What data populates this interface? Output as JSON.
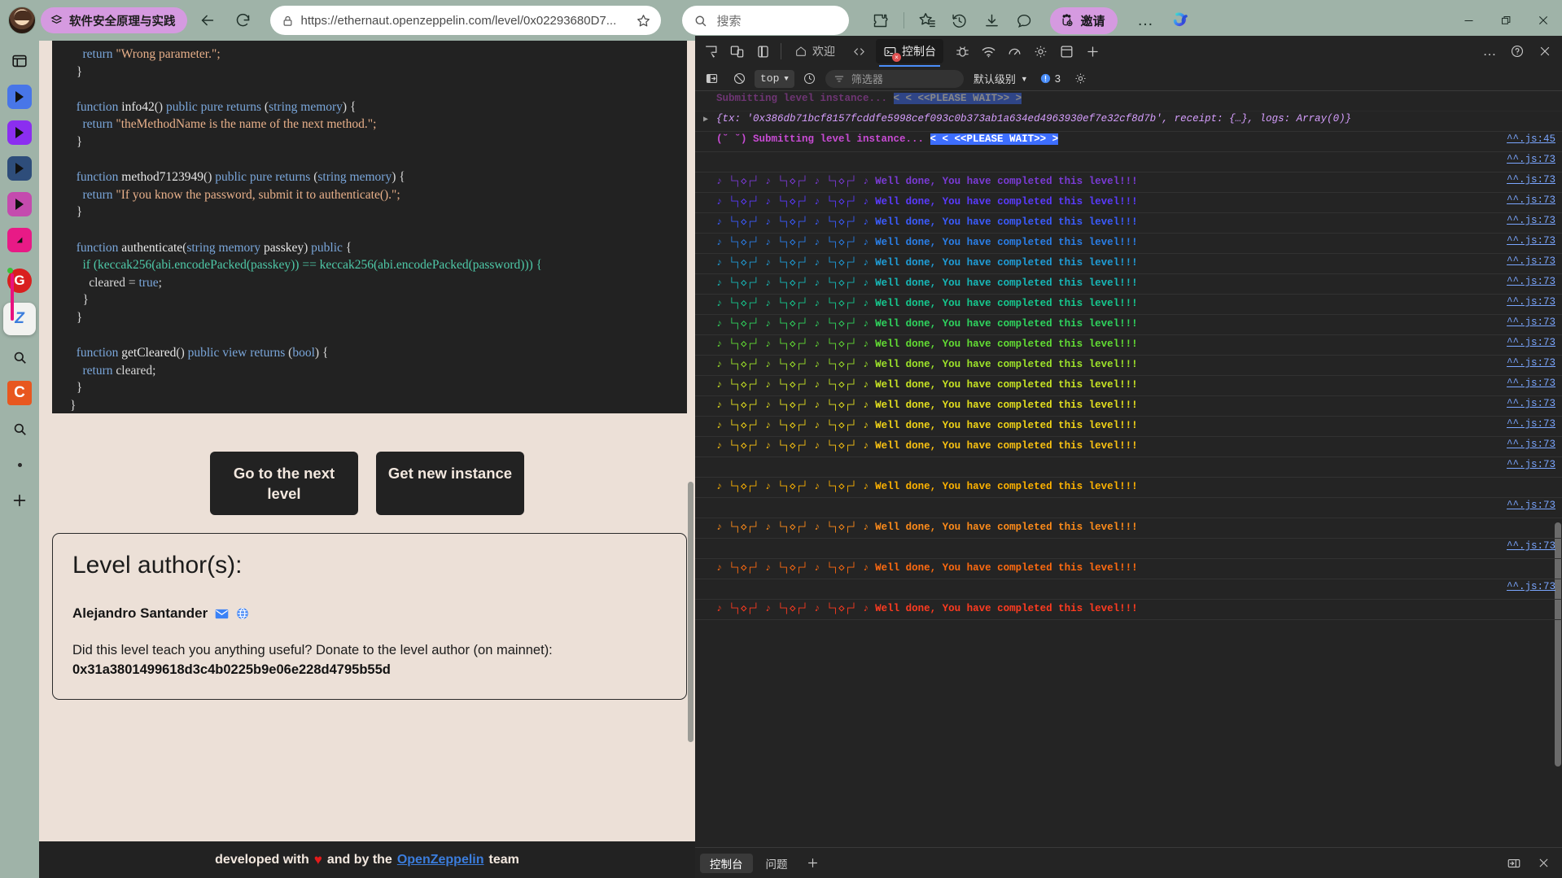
{
  "browser": {
    "profile_label": "软件安全原理与实践",
    "back_icon": "back-arrow-icon",
    "reload_icon": "reload-icon",
    "lock_icon": "lock-icon",
    "url": "https://ethernaut.openzeppelin.com/level/0x02293680D7...",
    "bookmark_icon": "star-icon",
    "search_placeholder": "搜索",
    "search_icon": "search-icon",
    "toolbar_icons": [
      "copilot-puzzle-icon",
      "favorites-icon",
      "history-icon",
      "downloads-icon",
      "chat-icon"
    ],
    "invite_label": "邀请",
    "more_label": "…",
    "window_buttons": [
      "minimize",
      "restore",
      "close"
    ]
  },
  "leftbar": {
    "items": [
      {
        "name": "split-screen-icon",
        "label": ""
      },
      {
        "name": "player-blue-icon",
        "label": ""
      },
      {
        "name": "player-purple-icon",
        "label": ""
      },
      {
        "name": "player-navy-icon",
        "label": ""
      },
      {
        "name": "player-magenta-icon",
        "label": ""
      },
      {
        "name": "player-pink-icon",
        "label": ""
      },
      {
        "name": "google-g-icon",
        "label": "G"
      },
      {
        "name": "zotero-icon",
        "label": "Z"
      },
      {
        "name": "search-icon",
        "label": ""
      },
      {
        "name": "c-app-icon",
        "label": "C"
      },
      {
        "name": "search-secondary-icon",
        "label": ""
      },
      {
        "name": "dot-icon",
        "label": ""
      },
      {
        "name": "add-icon",
        "label": "+"
      }
    ]
  },
  "page": {
    "code_lines": [
      [
        {
          "t": "    ",
          "c": "pl"
        },
        {
          "t": "return ",
          "c": "k"
        },
        {
          "t": "\"Wrong parameter.\";",
          "c": "str"
        }
      ],
      [
        {
          "t": "  }",
          "c": "pl"
        }
      ],
      [
        {
          "t": "",
          "c": "pl"
        }
      ],
      [
        {
          "t": "  ",
          "c": "pl"
        },
        {
          "t": "function ",
          "c": "k"
        },
        {
          "t": "info42",
          "c": "fn"
        },
        {
          "t": "() ",
          "c": "pl"
        },
        {
          "t": "public pure returns ",
          "c": "k"
        },
        {
          "t": "(",
          "c": "pl"
        },
        {
          "t": "string memory",
          "c": "ty"
        },
        {
          "t": ") {",
          "c": "pl"
        }
      ],
      [
        {
          "t": "    ",
          "c": "pl"
        },
        {
          "t": "return ",
          "c": "k"
        },
        {
          "t": "\"theMethodName is the name of the next method.\";",
          "c": "str"
        }
      ],
      [
        {
          "t": "  }",
          "c": "pl"
        }
      ],
      [
        {
          "t": "",
          "c": "pl"
        }
      ],
      [
        {
          "t": "  ",
          "c": "pl"
        },
        {
          "t": "function ",
          "c": "k"
        },
        {
          "t": "method7123949",
          "c": "fn"
        },
        {
          "t": "() ",
          "c": "pl"
        },
        {
          "t": "public pure returns ",
          "c": "k"
        },
        {
          "t": "(",
          "c": "pl"
        },
        {
          "t": "string memory",
          "c": "ty"
        },
        {
          "t": ") {",
          "c": "pl"
        }
      ],
      [
        {
          "t": "    ",
          "c": "pl"
        },
        {
          "t": "return ",
          "c": "k"
        },
        {
          "t": "\"If you know the password, submit it to authenticate().\";",
          "c": "str"
        }
      ],
      [
        {
          "t": "  }",
          "c": "pl"
        }
      ],
      [
        {
          "t": "",
          "c": "pl"
        }
      ],
      [
        {
          "t": "  ",
          "c": "pl"
        },
        {
          "t": "function ",
          "c": "k"
        },
        {
          "t": "authenticate",
          "c": "fn"
        },
        {
          "t": "(",
          "c": "pl"
        },
        {
          "t": "string memory ",
          "c": "ty"
        },
        {
          "t": "passkey",
          "c": "fn"
        },
        {
          "t": ") ",
          "c": "pl"
        },
        {
          "t": "public ",
          "c": "k"
        },
        {
          "t": "{",
          "c": "pl"
        }
      ],
      [
        {
          "t": "    ",
          "c": "pl"
        },
        {
          "t": "if ",
          "c": "grn"
        },
        {
          "t": "(keccak256(abi.encodePacked(passkey)) == keccak256(abi.encodePacked(password))) {",
          "c": "grn"
        }
      ],
      [
        {
          "t": "      cleared = ",
          "c": "pl"
        },
        {
          "t": "true",
          "c": "k"
        },
        {
          "t": ";",
          "c": "pl"
        }
      ],
      [
        {
          "t": "    }",
          "c": "pl"
        }
      ],
      [
        {
          "t": "  }",
          "c": "pl"
        }
      ],
      [
        {
          "t": "",
          "c": "pl"
        }
      ],
      [
        {
          "t": "  ",
          "c": "pl"
        },
        {
          "t": "function ",
          "c": "k"
        },
        {
          "t": "getCleared",
          "c": "fn"
        },
        {
          "t": "() ",
          "c": "pl"
        },
        {
          "t": "public view returns ",
          "c": "k"
        },
        {
          "t": "(",
          "c": "pl"
        },
        {
          "t": "bool",
          "c": "ty"
        },
        {
          "t": ") {",
          "c": "pl"
        }
      ],
      [
        {
          "t": "    ",
          "c": "pl"
        },
        {
          "t": "return ",
          "c": "k"
        },
        {
          "t": "cleared;",
          "c": "pl"
        }
      ],
      [
        {
          "t": "  }",
          "c": "pl"
        }
      ],
      [
        {
          "t": "}",
          "c": "pl"
        }
      ]
    ],
    "buttons": {
      "next_level": "Go to the next level",
      "new_instance": "Get new instance"
    },
    "author": {
      "title": "Level author(s):",
      "name": "Alejandro Santander",
      "mail_icon": "envelope-icon",
      "web_icon": "globe-icon",
      "donate_question": "Did this level teach you anything useful? Donate to the level author (on mainnet):",
      "donate_address": "0x31a3801499618d3c4b0225b9e06e228d4795b55d"
    },
    "footer": {
      "prefix": "developed with",
      "heart": "♥",
      "middle": "and  by the",
      "link": "OpenZeppelin",
      "suffix": "team"
    }
  },
  "devtools": {
    "tabs": [
      {
        "label": "欢迎",
        "icon": "home-icon",
        "active": false
      },
      {
        "label": "",
        "icon": "elements-icon",
        "active": false
      },
      {
        "label": "控制台",
        "icon": "console-icon",
        "active": true
      }
    ],
    "icon_tabs": [
      "inspect-icon",
      "device-toolbar-icon",
      "panel-layout-icon"
    ],
    "right_icons": [
      "debugger-icon",
      "network-icon",
      "performance-icon",
      "settings-gear-icon",
      "application-icon",
      "add-tab-icon"
    ],
    "more_label": "…",
    "help_icon": "help-icon",
    "close_icon": "close-icon",
    "toolbar": {
      "sidebar_icon": "console-sidebar-icon",
      "clear_icon": "clear-console-icon",
      "context": "top",
      "eye_icon": "live-expression-icon",
      "filter_placeholder": "筛选器",
      "filter_icon": "filter-icon",
      "level": "默认级别",
      "warn_icon": "warning-bubble-icon",
      "warn_count": "3",
      "settings_icon": "console-settings-icon"
    },
    "bottom_tabs": [
      {
        "label": "控制台",
        "active": true
      },
      {
        "label": "问题",
        "active": false
      }
    ],
    "bottom_add": "+",
    "bottom_right_icons": [
      "dock-icon",
      "close-drawer-icon"
    ],
    "console_rows": [
      {
        "kind": "partial",
        "text": "Submitting level instance...",
        "highlight": "< < <<PLEASE WAIT>> >",
        "src": ""
      },
      {
        "kind": "object",
        "text": "{tx: '0x386db71bcf8157fcddfe5998cef093c0b373ab1a634ed4963930ef7e32cf8d7b', receipt: {…}, logs: Array(0)}",
        "src": ""
      },
      {
        "kind": "submit",
        "text": "(˘ ˘) Submitting level instance...",
        "highlight": "< < <<PLEASE WAIT>> >",
        "src": "^^.js:45",
        "color": "#c84bd4"
      },
      {
        "kind": "blank",
        "text": "",
        "src": "^^.js:73"
      },
      {
        "kind": "done",
        "text": "♪ └┐◇┌┘ ♪ └┐◇┌┘ ♪ └┐◇┌┘ ♪ Well done, You have completed this level!!!",
        "src": "^^.js:73",
        "color": "#7a3bd6"
      },
      {
        "kind": "done",
        "text": "♪ └┐◇┌┘ ♪ └┐◇┌┘ ♪ └┐◇┌┘ ♪ Well done, You have completed this level!!!",
        "src": "^^.js:73",
        "color": "#5a3bff"
      },
      {
        "kind": "done",
        "text": "♪ └┐◇┌┘ ♪ └┐◇┌┘ ♪ └┐◇┌┘ ♪ Well done, You have completed this level!!!",
        "src": "^^.js:73",
        "color": "#3b5cff"
      },
      {
        "kind": "done",
        "text": "♪ └┐◇┌┘ ♪ └┐◇┌┘ ♪ └┐◇┌┘ ♪ Well done, You have completed this level!!!",
        "src": "^^.js:73",
        "color": "#2a7fe8"
      },
      {
        "kind": "done",
        "text": "♪ └┐◇┌┘ ♪ └┐◇┌┘ ♪ └┐◇┌┘ ♪ Well done, You have completed this level!!!",
        "src": "^^.js:73",
        "color": "#1f9ed8"
      },
      {
        "kind": "done",
        "text": "♪ └┐◇┌┘ ♪ └┐◇┌┘ ♪ └┐◇┌┘ ♪ Well done, You have completed this level!!!",
        "src": "^^.js:73",
        "color": "#17b8b8"
      },
      {
        "kind": "done",
        "text": "♪ └┐◇┌┘ ♪ └┐◇┌┘ ♪ └┐◇┌┘ ♪ Well done, You have completed this level!!!",
        "src": "^^.js:73",
        "color": "#16c98e"
      },
      {
        "kind": "done",
        "text": "♪ └┐◇┌┘ ♪ └┐◇┌┘ ♪ └┐◇┌┘ ♪ Well done, You have completed this level!!!",
        "src": "^^.js:73",
        "color": "#2fd45e"
      },
      {
        "kind": "done",
        "text": "♪ └┐◇┌┘ ♪ └┐◇┌┘ ♪ └┐◇┌┘ ♪ Well done, You have completed this level!!!",
        "src": "^^.js:73",
        "color": "#63dd33"
      },
      {
        "kind": "done",
        "text": "♪ └┐◇┌┘ ♪ └┐◇┌┘ ♪ └┐◇┌┘ ♪ Well done, You have completed this level!!!",
        "src": "^^.js:73",
        "color": "#9ee42a"
      },
      {
        "kind": "done",
        "text": "♪ └┐◇┌┘ ♪ └┐◇┌┘ ♪ └┐◇┌┘ ♪ Well done, You have completed this level!!!",
        "src": "^^.js:73",
        "color": "#c8e424"
      },
      {
        "kind": "done",
        "text": "♪ └┐◇┌┘ ♪ └┐◇┌┘ ♪ └┐◇┌┘ ♪ Well done, You have completed this level!!!",
        "src": "^^.js:73",
        "color": "#e4e01f"
      },
      {
        "kind": "done",
        "text": "♪ └┐◇┌┘ ♪ └┐◇┌┘ ♪ └┐◇┌┘ ♪ Well done, You have completed this level!!!",
        "src": "^^.js:73",
        "color": "#f2d417"
      },
      {
        "kind": "done",
        "text": "♪ └┐◇┌┘ ♪ └┐◇┌┘ ♪ └┐◇┌┘ ♪ Well done, You have completed this level!!!",
        "src": "^^.js:73",
        "color": "#fbc312"
      },
      {
        "kind": "blank",
        "text": "",
        "src": "^^.js:73"
      },
      {
        "kind": "done",
        "text": "♪ └┐◇┌┘ ♪ └┐◇┌┘ ♪ └┐◇┌┘ ♪ Well done, You have completed this level!!!",
        "src": "",
        "color": "#ffb300"
      },
      {
        "kind": "blank",
        "text": "",
        "src": "^^.js:73"
      },
      {
        "kind": "done",
        "text": "♪ └┐◇┌┘ ♪ └┐◇┌┘ ♪ └┐◇┌┘ ♪ Well done, You have completed this level!!!",
        "src": "",
        "color": "#ff8c1a"
      },
      {
        "kind": "blank",
        "text": "",
        "src": "^^.js:73"
      },
      {
        "kind": "done-wrap",
        "text": "♪ └┐◇┌┘ ♪ └┐◇┌┘ ♪ └┐◇┌┘ ♪ Well done, You have completed this level!!!",
        "src": "",
        "color": "#ff6a10"
      },
      {
        "kind": "blank",
        "text": "",
        "src": "^^.js:73"
      },
      {
        "kind": "done-wrap",
        "text": "♪ └┐◇┌┘ ♪ └┐◇┌┘ ♪ └┐◇┌┘ ♪ Well done, You have completed this level!!!",
        "src": "",
        "color": "#ff3b20"
      }
    ]
  }
}
